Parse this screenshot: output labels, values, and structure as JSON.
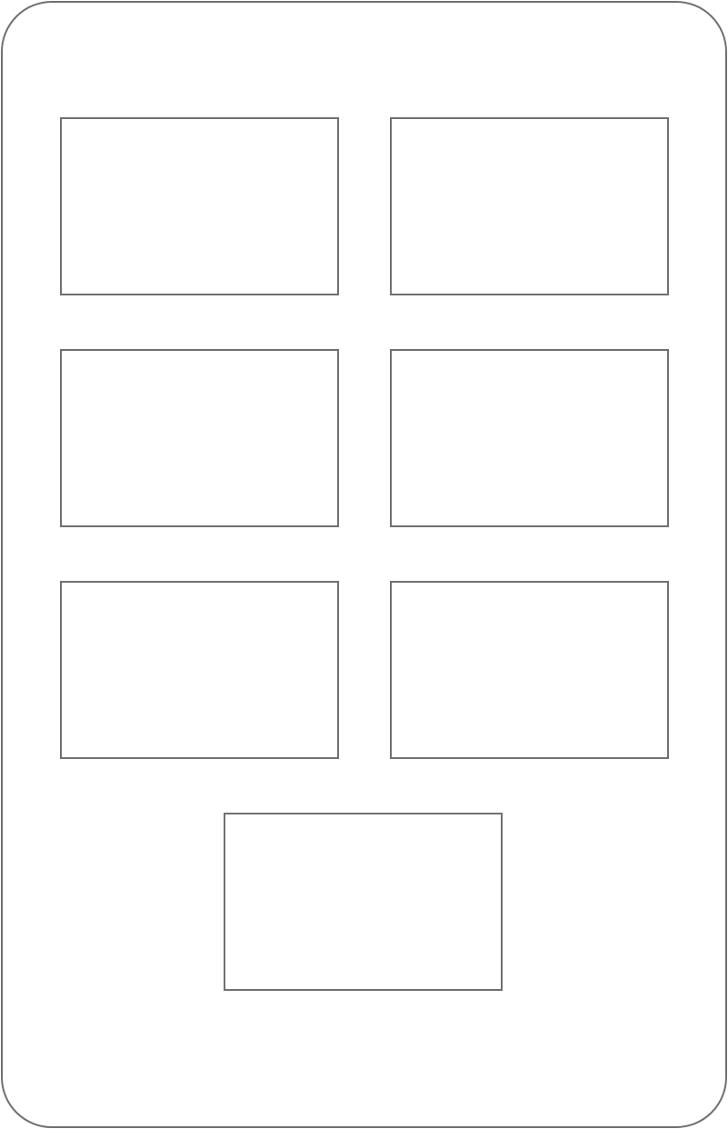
{
  "colors": {
    "stroke": "#707070",
    "background": "#ffffff"
  },
  "panels": [
    {
      "label": ""
    },
    {
      "label": ""
    },
    {
      "label": ""
    },
    {
      "label": ""
    },
    {
      "label": ""
    },
    {
      "label": ""
    },
    {
      "label": ""
    }
  ]
}
